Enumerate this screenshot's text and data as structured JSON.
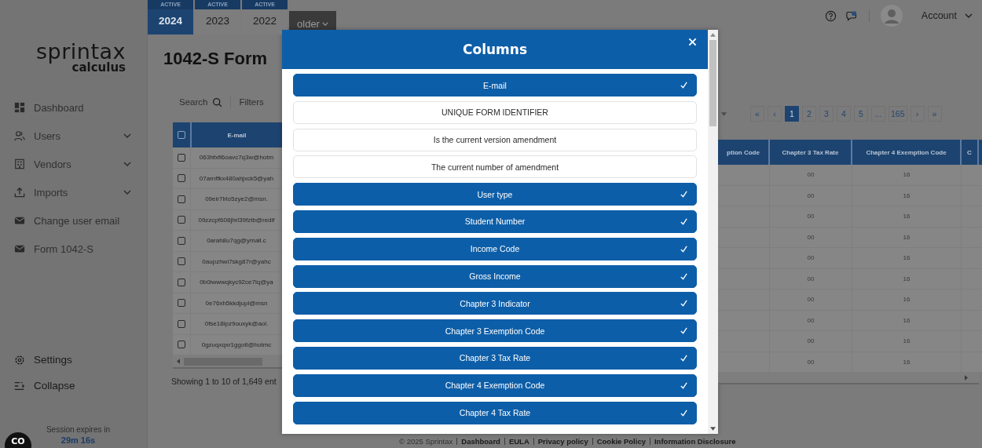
{
  "year_tabs": [
    {
      "badge": "ACTIVE",
      "label": "2024",
      "selected": true
    },
    {
      "badge": "ACTIVE",
      "label": "2023",
      "selected": false
    },
    {
      "badge": "ACTIVE",
      "label": "2022",
      "selected": false
    }
  ],
  "older": {
    "label": "older"
  },
  "header": {
    "account": "Account"
  },
  "sidebar": {
    "logo": "sprintax",
    "logo_sub": "calculus",
    "items": [
      {
        "label": "Dashboard",
        "expandable": false
      },
      {
        "label": "Users",
        "expandable": true
      },
      {
        "label": "Vendors",
        "expandable": true
      },
      {
        "label": "Imports",
        "expandable": true
      },
      {
        "label": "Change user email",
        "expandable": false
      },
      {
        "label": "Form 1042-S",
        "expandable": false
      }
    ],
    "bottom_items": [
      {
        "label": "Settings"
      },
      {
        "label": "Collapse"
      }
    ],
    "session": {
      "label": "Session expires in",
      "time": "29m 16s"
    }
  },
  "corner_button": {
    "label": "CO"
  },
  "page": {
    "title": "1042-S Form",
    "search": "Search",
    "filters": "Filters"
  },
  "table_left": {
    "header_checked": false,
    "email_header": "E-mail",
    "rows": [
      {
        "email": "063hfxfl6oavc7q3w@hotm",
        "checked": false
      },
      {
        "email": "07arnffkx480ahjxck5@yah",
        "checked": false
      },
      {
        "email": "09eir7lrlo5zye2@msn.",
        "checked": false
      },
      {
        "email": "09zzcpf608jhrl39fztb@redif",
        "checked": false
      },
      {
        "email": "0arah8u7qg@ymail.c",
        "checked": false
      },
      {
        "email": "0aupzhwi7skg87r@yahc",
        "checked": false
      },
      {
        "email": "0b0iwwwqkyc92ce7lq@ya",
        "checked": false
      },
      {
        "email": "0e76xh5kkdjupl@msn",
        "checked": false
      },
      {
        "email": "0fse18ipz9ouxyk@aol.",
        "checked": false
      },
      {
        "email": "0gzuqxqxr1ggotl@hotmc",
        "checked": false
      }
    ]
  },
  "showing": "Showing 1 to 10 of 1,649 ent",
  "pagination": [
    {
      "label": "«",
      "selected": false
    },
    {
      "label": "‹",
      "selected": false
    },
    {
      "label": "1",
      "selected": true
    },
    {
      "label": "2",
      "selected": false
    },
    {
      "label": "3",
      "selected": false
    },
    {
      "label": "4",
      "selected": false
    },
    {
      "label": "5",
      "selected": false
    },
    {
      "label": "...",
      "selected": false
    },
    {
      "label": "165",
      "selected": false
    },
    {
      "label": "›",
      "selected": false
    },
    {
      "label": "»",
      "selected": false
    }
  ],
  "table_right": {
    "columns": [
      "ption Code",
      "Chapter 3 Tax Rate",
      "Chapter 4 Exemption Code",
      "C"
    ],
    "rows": [
      [
        "",
        "00",
        "16",
        ""
      ],
      [
        "",
        "00",
        "16",
        ""
      ],
      [
        "",
        "00",
        "16",
        ""
      ],
      [
        "",
        "00",
        "16",
        ""
      ],
      [
        "",
        "00",
        "16",
        ""
      ],
      [
        "",
        "00",
        "16",
        ""
      ],
      [
        "",
        "00",
        "16",
        ""
      ],
      [
        "",
        "00",
        "16",
        ""
      ],
      [
        "",
        "00",
        "16",
        ""
      ],
      [
        "",
        "00",
        "16",
        ""
      ]
    ]
  },
  "footer": {
    "copyright": "© 2025 Sprintax",
    "links": [
      "Dashboard",
      "EULA",
      "Privacy policy",
      "Cookie Policy",
      "Information Disclosure"
    ]
  },
  "modal": {
    "title": "Columns",
    "options": [
      {
        "label": "E-mail",
        "selected": true
      },
      {
        "label": "UNIQUE FORM IDENTIFIER",
        "selected": false
      },
      {
        "label": "Is the current version amendment",
        "selected": false
      },
      {
        "label": "The current number of amendment",
        "selected": false
      },
      {
        "label": "User type",
        "selected": true
      },
      {
        "label": "Student Number",
        "selected": true
      },
      {
        "label": "Income Code",
        "selected": true
      },
      {
        "label": "Gross Income",
        "selected": true
      },
      {
        "label": "Chapter 3 Indicator",
        "selected": true
      },
      {
        "label": "Chapter 3 Exemption Code",
        "selected": true
      },
      {
        "label": "Chapter 3 Tax Rate",
        "selected": true
      },
      {
        "label": "Chapter 4 Exemption Code",
        "selected": true
      },
      {
        "label": "Chapter 4 Tax Rate",
        "selected": true
      }
    ]
  }
}
